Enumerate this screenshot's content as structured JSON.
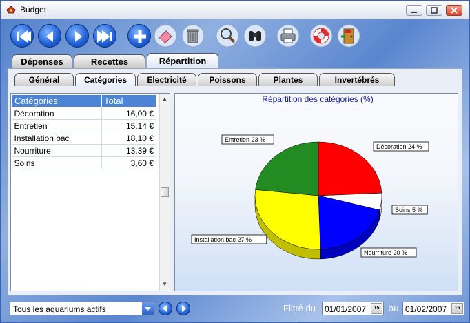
{
  "window": {
    "title": "Budget"
  },
  "toolbar": {
    "icons": [
      "first-record-icon",
      "previous-record-icon",
      "next-record-icon",
      "last-record-icon",
      "add-icon",
      "eraser-icon",
      "trash-icon",
      "magnifier-icon",
      "binoculars-icon",
      "printer-icon",
      "lifebuoy-icon",
      "exit-door-icon"
    ]
  },
  "tabs": [
    {
      "label": "Dépenses"
    },
    {
      "label": "Recettes"
    },
    {
      "label": "Répartition",
      "active": true
    }
  ],
  "subtabs": [
    {
      "label": "Général"
    },
    {
      "label": "Catégories",
      "active": true
    },
    {
      "label": "Electricité"
    },
    {
      "label": "Poissons"
    },
    {
      "label": "Plantes"
    },
    {
      "label": "Invertébrés"
    }
  ],
  "table": {
    "headers": [
      "Catégories",
      "Total"
    ],
    "rows": [
      [
        "Décoration",
        "16,00 €"
      ],
      [
        "Entretien",
        "15,14 €"
      ],
      [
        "Installation bac",
        "18,10 €"
      ],
      [
        "Nourriture",
        "13,39 €"
      ],
      [
        "Soins",
        "3,60 €"
      ]
    ]
  },
  "chart_data": {
    "type": "pie",
    "title": "Répartition des catégories (%)",
    "slices": [
      {
        "label": "Décoration 24 %",
        "value": 24,
        "color": "#ff0000"
      },
      {
        "label": "Soins 5 %",
        "value": 5,
        "color": "#ffffff"
      },
      {
        "label": "Nourriture 20 %",
        "value": 20,
        "color": "#0000ff"
      },
      {
        "label": "Installation bac 27 %",
        "value": 27,
        "color": "#ffff00"
      },
      {
        "label": "Entretien 23 %",
        "value": 23,
        "color": "#228b22"
      }
    ]
  },
  "bottom": {
    "aquarium_filter": "Tous les aquariums actifs",
    "filter_from_label": "Filtré du",
    "date_from": "01/01/2007",
    "to_label": "au",
    "date_to": "01/02/2007",
    "calendar_label": "15"
  }
}
